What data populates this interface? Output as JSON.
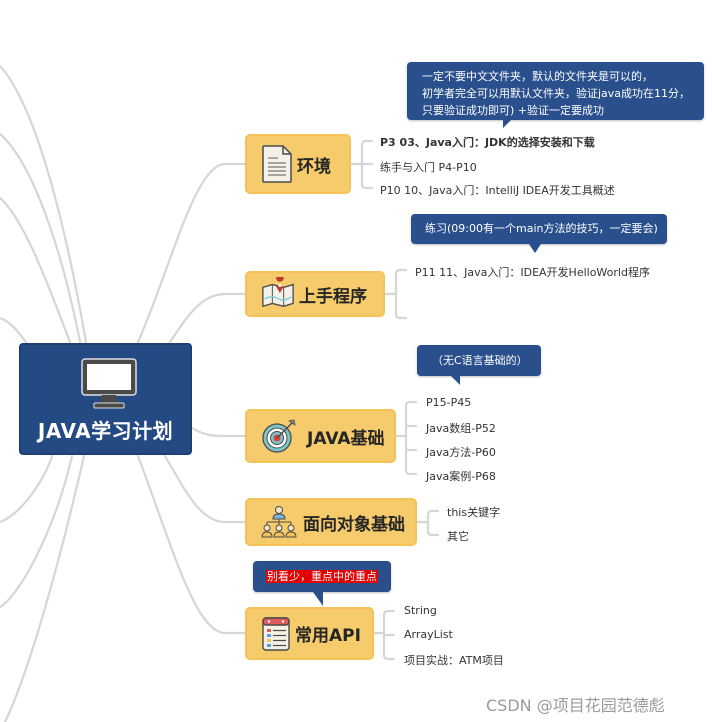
{
  "root": {
    "title": "JAVA学习计划",
    "icon": "monitor-icon"
  },
  "topics": [
    {
      "id": "env",
      "title": "环境",
      "icon": "document-icon",
      "note": "一定不要中文文件夹，默认的文件夹是可以的，\n初学者完全可以用默认文件夹，验证java成功在11分，\n只要验证成功即可) +验证一定要成功",
      "children": [
        {
          "label": "P3 03、Java入门：JDK的选择安装和下载",
          "bold": true
        },
        {
          "label": "练手与入门 P4-P10",
          "bold": false
        },
        {
          "label": "P10 10、Java入门：IntelliJ IDEA开发工具概述",
          "bold": false
        }
      ]
    },
    {
      "id": "start",
      "title": "上手程序",
      "icon": "map-pin-icon",
      "note": "练习(09:00有一个main方法的技巧，一定要会)",
      "children": [
        {
          "label": "P11 11、Java入门：IDEA开发HelloWorld程序",
          "bold": false
        }
      ]
    },
    {
      "id": "basics",
      "title": "JAVA基础",
      "icon": "target-icon",
      "note": "（无C语言基础的）",
      "children": [
        {
          "label": "P15-P45"
        },
        {
          "label": "Java数组-P52"
        },
        {
          "label": "Java方法-P60"
        },
        {
          "label": "Java案例-P68"
        }
      ]
    },
    {
      "id": "oop",
      "title": "面向对象基础",
      "icon": "org-chart-icon",
      "children": [
        {
          "label": "this关键字"
        },
        {
          "label": "其它"
        }
      ]
    },
    {
      "id": "api",
      "title": "常用API",
      "icon": "checklist-icon",
      "note": "别看少，重点中的重点",
      "note_highlight_color": "#e30000",
      "children": [
        {
          "label": "String"
        },
        {
          "label": "ArrayList"
        },
        {
          "label": "项目实战：ATM项目"
        }
      ]
    }
  ],
  "watermark": "CSDN @项目花园范德彪",
  "colors": {
    "root_bg": "#244a84",
    "topic_bg": "#f5cb6b",
    "callout_bg": "#2a4f8d",
    "link": "#d6d6d6",
    "highlight": "#e30000"
  }
}
